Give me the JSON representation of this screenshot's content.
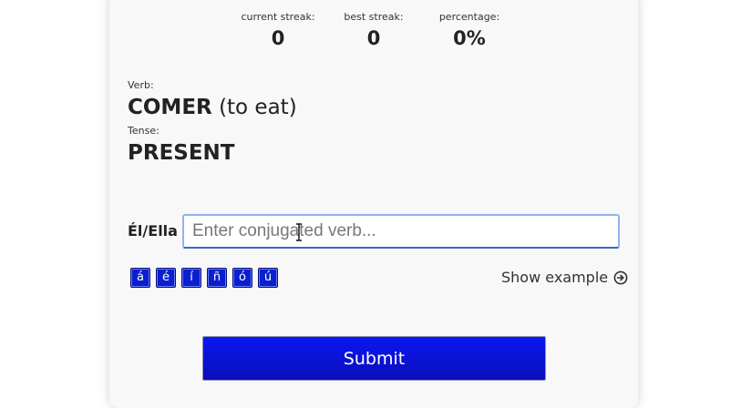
{
  "stats": {
    "current_streak": {
      "label": "current streak:",
      "value": "0"
    },
    "best_streak": {
      "label": "best streak:",
      "value": "0"
    },
    "percentage": {
      "label": "percentage:",
      "value": "0%"
    }
  },
  "verb": {
    "label": "Verb:",
    "infinitive": "COMER",
    "translation": "(to eat)"
  },
  "tense": {
    "label": "Tense:",
    "value": "PRESENT"
  },
  "answer": {
    "pronoun": "Él/Ella",
    "value": "",
    "placeholder": "Enter conjugated verb..."
  },
  "accent_buttons": [
    "á",
    "é",
    "í",
    "ñ",
    "ó",
    "ú"
  ],
  "show_example": {
    "label": "Show example",
    "icon": "arrow-circle-right-icon"
  },
  "submit": {
    "label": "Submit"
  },
  "colors": {
    "accent_blue": "#0a1fd0",
    "input_focus_border": "#8fb3ee",
    "card_background": "#f8f8f8"
  }
}
